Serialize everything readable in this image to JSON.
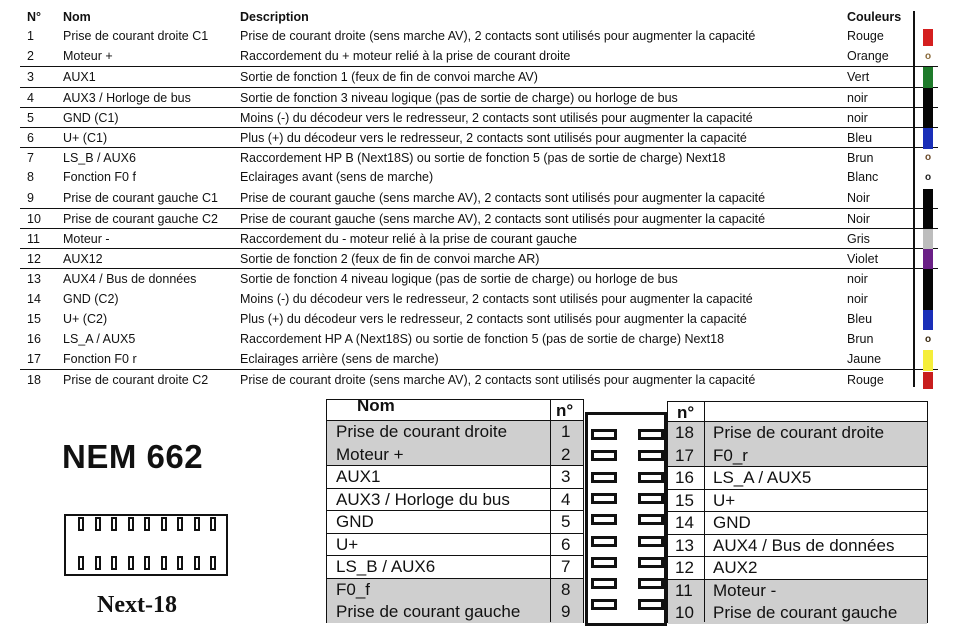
{
  "pin_table": {
    "headers": {
      "no": "N°",
      "nom": "Nom",
      "description": "Description",
      "couleurs": "Couleurs"
    },
    "rows": [
      {
        "no": "1",
        "nom": "Prise de courant droite C1",
        "description": "Prise de courant droite (sens marche AV), 2 contacts sont utilisés pour augmenter la capacité",
        "couleur": "Rouge",
        "swatch": "#d41f1f",
        "marker": "bar"
      },
      {
        "no": "2",
        "nom": "Moteur +",
        "description": "Raccordement du + moteur relié à la prise de courant droite",
        "couleur": "Orange",
        "swatch": "#8a6a3a",
        "marker": "ring"
      },
      {
        "no": "3",
        "nom": "AUX1",
        "description": "Sortie de fonction 1 (feux de fin de convoi marche AV)",
        "couleur": "Vert",
        "swatch": "#1e7a2a",
        "marker": "bar"
      },
      {
        "no": "4",
        "nom": "AUX3 / Horloge de bus",
        "description": "Sortie de fonction 3 niveau logique (pas de sortie de charge) ou horloge de bus",
        "couleur": "noir",
        "swatch": "#050505",
        "marker": "bar"
      },
      {
        "no": "5",
        "nom": "GND (C1)",
        "description": "Moins (-) du décodeur vers le redresseur, 2 contacts sont utilisés pour augmenter la capacité",
        "couleur": "noir",
        "swatch": "#050505",
        "marker": "bar"
      },
      {
        "no": "6",
        "nom": "U+ (C1)",
        "description": "Plus (+) du décodeur vers le redresseur, 2 contacts sont utilisés pour augmenter la capacité",
        "couleur": "Bleu",
        "swatch": "#1a2fb8",
        "marker": "bar"
      },
      {
        "no": "7",
        "nom": "LS_B / AUX6",
        "description": "Raccordement HP B (Next18S) ou sortie de fonction 5 (pas de sortie de charge) Next18",
        "couleur": "Brun",
        "swatch": "#6b4a2a",
        "marker": "ring"
      },
      {
        "no": "8",
        "nom": "Fonction F0 f",
        "description": "Eclairages avant (sens de marche)",
        "couleur": "Blanc",
        "swatch": "#222222",
        "marker": "ring"
      },
      {
        "no": "9",
        "nom": "Prise de courant gauche C1",
        "description": "Prise de courant gauche (sens marche AV), 2 contacts sont utilisés pour augmenter la capacité",
        "couleur": "Noir",
        "swatch": "#050505",
        "marker": "bar"
      },
      {
        "no": "10",
        "nom": "Prise de courant gauche C2",
        "description": "Prise de courant gauche (sens marche AV), 2 contacts sont utilisés pour augmenter la capacité",
        "couleur": "Noir",
        "swatch": "#050505",
        "marker": "bar"
      },
      {
        "no": "11",
        "nom": "Moteur -",
        "description": "Raccordement du - moteur relié à la prise de courant gauche",
        "couleur": "Gris",
        "swatch": "#bdbdbd",
        "marker": "bar"
      },
      {
        "no": "12",
        "nom": "AUX12",
        "description": "Sortie de fonction 2 (feux de fin de convoi marche AR)",
        "couleur": "Violet",
        "swatch": "#6a1f86",
        "marker": "bar"
      },
      {
        "no": "13",
        "nom": "AUX4 / Bus de données",
        "description": "Sortie de fonction 4 niveau logique (pas de sortie de charge) ou horloge de bus",
        "couleur": "noir",
        "swatch": "#050505",
        "marker": "bar"
      },
      {
        "no": "14",
        "nom": "GND (C2)",
        "description": "Moins (-) du décodeur vers le redresseur, 2 contacts sont utilisés pour augmenter la capacité",
        "couleur": "noir",
        "swatch": "#050505",
        "marker": "bar"
      },
      {
        "no": "15",
        "nom": "U+ (C2)",
        "description": "Plus (+) du décodeur vers le redresseur, 2 contacts sont utilisés pour augmenter la capacité",
        "couleur": "Bleu",
        "swatch": "#1a2fb8",
        "marker": "bar"
      },
      {
        "no": "16",
        "nom": "LS_A / AUX5",
        "description": "Raccordement HP A (Next18S) ou sortie de fonction 5 (pas de sortie de charge) Next18",
        "couleur": "Brun",
        "swatch": "#3a2a10",
        "marker": "ring"
      },
      {
        "no": "17",
        "nom": "Fonction F0 r",
        "description": "Eclairages arrière (sens de marche)",
        "couleur": "Jaune",
        "swatch": "#f5ee3a",
        "marker": "bar"
      },
      {
        "no": "18",
        "nom": "Prise de courant droite C2",
        "description": "Prise de courant droite (sens marche AV), 2 contacts sont utilisés pour augmenter la capacité",
        "couleur": "Rouge",
        "swatch": "#c81e1e",
        "marker": "bar"
      }
    ],
    "separators_before": [
      3,
      4,
      5,
      6,
      7,
      10,
      11,
      12,
      13,
      18
    ]
  },
  "logo": {
    "title": "NEM 662",
    "connector_label": "Next-18"
  },
  "left_pinout": {
    "header_nom": "Nom",
    "header_no": "n°",
    "groups": [
      {
        "shaded": true,
        "entries": [
          {
            "name": "Prise de courant droite",
            "no": "1"
          },
          {
            "name": "Moteur +",
            "no": "2"
          }
        ]
      },
      {
        "shaded": false,
        "entries": [
          {
            "name": "AUX1",
            "no": "3"
          }
        ]
      },
      {
        "shaded": false,
        "entries": [
          {
            "name": "AUX3 / Horloge du bus",
            "no": "4"
          }
        ]
      },
      {
        "shaded": false,
        "entries": [
          {
            "name": "GND",
            "no": "5"
          }
        ]
      },
      {
        "shaded": false,
        "entries": [
          {
            "name": "U+",
            "no": "6"
          }
        ]
      },
      {
        "shaded": false,
        "entries": [
          {
            "name": "LS_B / AUX6",
            "no": "7"
          }
        ]
      },
      {
        "shaded": true,
        "entries": [
          {
            "name": "F0_f",
            "no": "8"
          },
          {
            "name": "Prise de courant gauche",
            "no": "9"
          }
        ]
      }
    ]
  },
  "right_pinout": {
    "header_no": "n°",
    "header_nom": "",
    "groups": [
      {
        "shaded": true,
        "entries": [
          {
            "no": "18",
            "name": "Prise de courant droite"
          },
          {
            "no": "17",
            "name": "F0_r"
          }
        ]
      },
      {
        "shaded": false,
        "entries": [
          {
            "no": "16",
            "name": "LS_A / AUX5"
          }
        ]
      },
      {
        "shaded": false,
        "entries": [
          {
            "no": "15",
            "name": "U+"
          }
        ]
      },
      {
        "shaded": false,
        "entries": [
          {
            "no": "14",
            "name": "GND"
          }
        ]
      },
      {
        "shaded": false,
        "entries": [
          {
            "no": "13",
            "name": "AUX4 / Bus de données"
          }
        ]
      },
      {
        "shaded": false,
        "entries": [
          {
            "no": "12",
            "name": "AUX2"
          }
        ]
      },
      {
        "shaded": true,
        "entries": [
          {
            "no": "11",
            "name": "Moteur -"
          },
          {
            "no": "10",
            "name": "Prise de courant gauche"
          }
        ]
      }
    ]
  },
  "colors": {
    "shade": "#cfcfcf",
    "line": "#111111"
  }
}
